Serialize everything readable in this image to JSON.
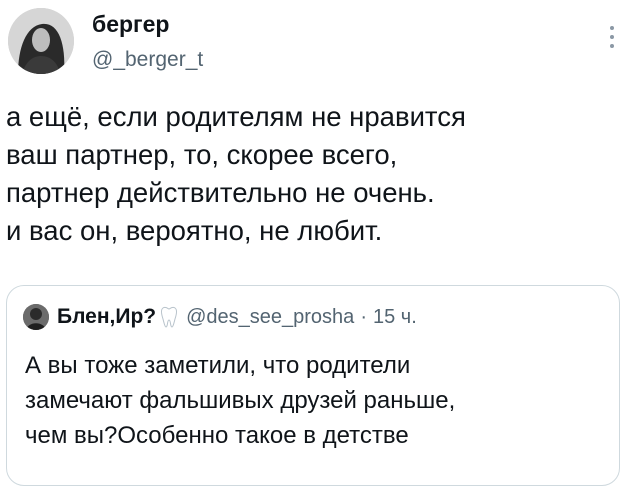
{
  "author": {
    "display_name": "бергер",
    "handle": "@_berger_t"
  },
  "tweet": {
    "lines": [
      "а ещё, если родителям не нравится",
      "ваш партнер, то, скорее всего,",
      "партнер действительно не очень.",
      "и вас он, вероятно, не любит."
    ]
  },
  "quote": {
    "display_name": "Блен,Ир?",
    "handle": "@des_see_prosha",
    "separator": "·",
    "time": "15 ч.",
    "lines": [
      "А вы тоже заметили, что родители",
      "замечают фальшивых друзей раньше,",
      "чем вы?Особенно такое в детстве"
    ]
  },
  "icons": {
    "more": "more-vertical-icon",
    "badge": "tooth-icon"
  },
  "colors": {
    "text": "#0f1419",
    "secondary": "#536471",
    "border": "#cfd9de"
  }
}
